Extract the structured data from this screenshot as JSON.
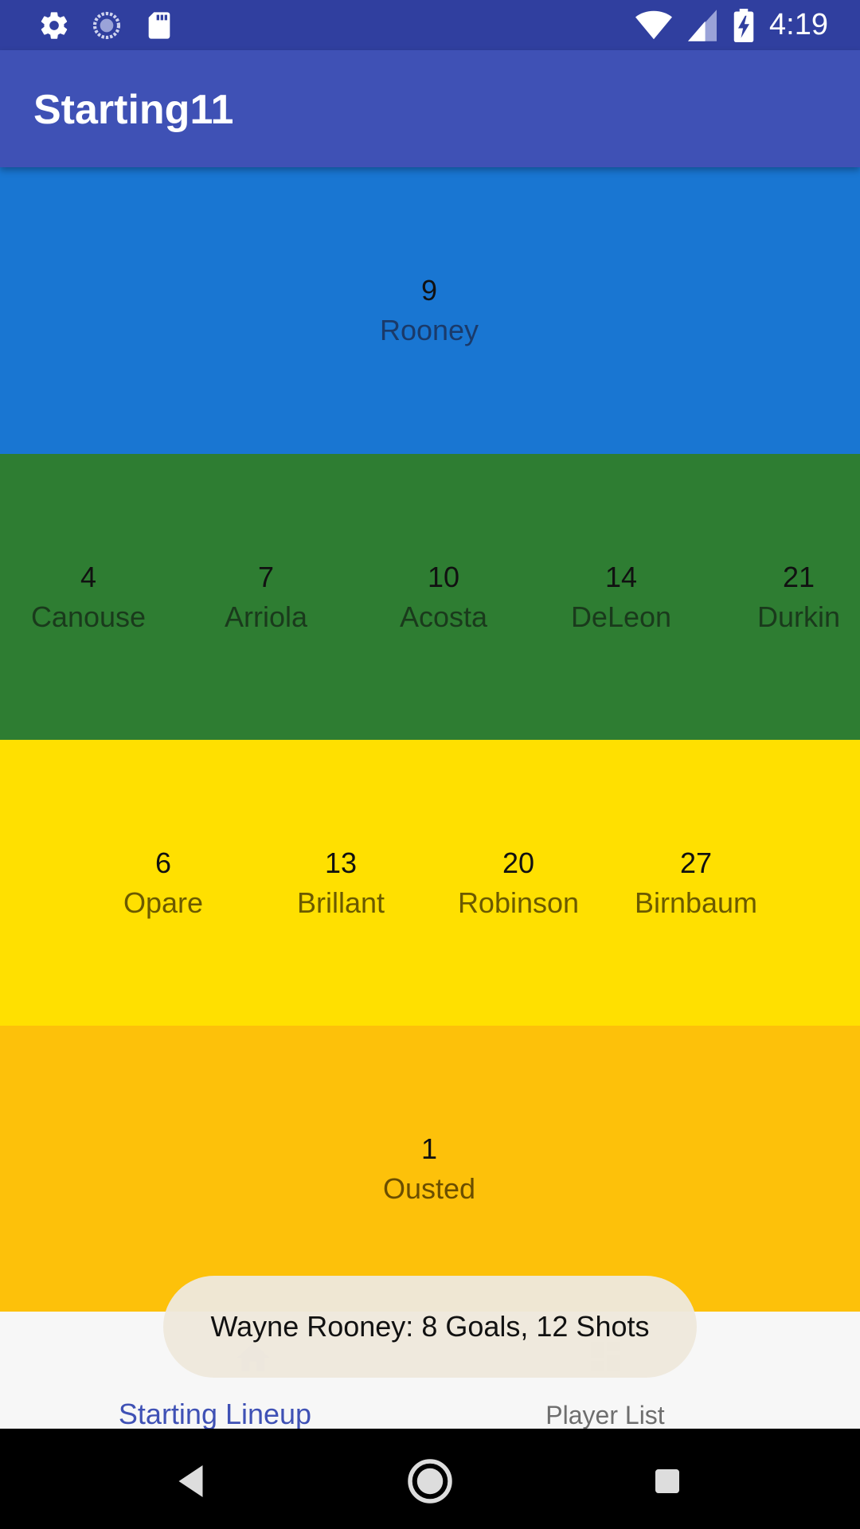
{
  "status_bar": {
    "time": "4:19",
    "left_icons": [
      "gear-icon",
      "sync-icon",
      "sd-card-icon"
    ],
    "right_icons": [
      "wifi-icon",
      "signal-icon",
      "battery-charging-icon"
    ]
  },
  "app_bar": {
    "title": "Starting11"
  },
  "lineup": {
    "forwards": [
      {
        "number": "9",
        "name": "Rooney"
      }
    ],
    "midfielders": [
      {
        "number": "4",
        "name": "Canouse"
      },
      {
        "number": "7",
        "name": "Arriola"
      },
      {
        "number": "10",
        "name": "Acosta"
      },
      {
        "number": "14",
        "name": "DeLeon"
      },
      {
        "number": "21",
        "name": "Durkin"
      }
    ],
    "defenders": [
      {
        "number": "6",
        "name": "Opare"
      },
      {
        "number": "13",
        "name": "Brillant"
      },
      {
        "number": "20",
        "name": "Robinson"
      },
      {
        "number": "27",
        "name": "Birnbaum"
      }
    ],
    "goalkeeper": [
      {
        "number": "1",
        "name": "Ousted"
      }
    ]
  },
  "toast": {
    "text": "Wayne Rooney: 8 Goals, 12 Shots"
  },
  "bottom_nav": {
    "items": [
      {
        "label": "Starting Lineup",
        "icon": "home-icon",
        "selected": true
      },
      {
        "label": "Player List",
        "icon": "dashboard-icon",
        "selected": false
      }
    ]
  },
  "colors": {
    "status_bar": "#303F9F",
    "app_bar": "#3F51B5",
    "forwards_band": "#1976D2",
    "midfielders_band": "#2E7D32",
    "defenders_band": "#FFE000",
    "goalkeeper_band": "#FDC10A",
    "nav_selected": "#3F51B5"
  }
}
